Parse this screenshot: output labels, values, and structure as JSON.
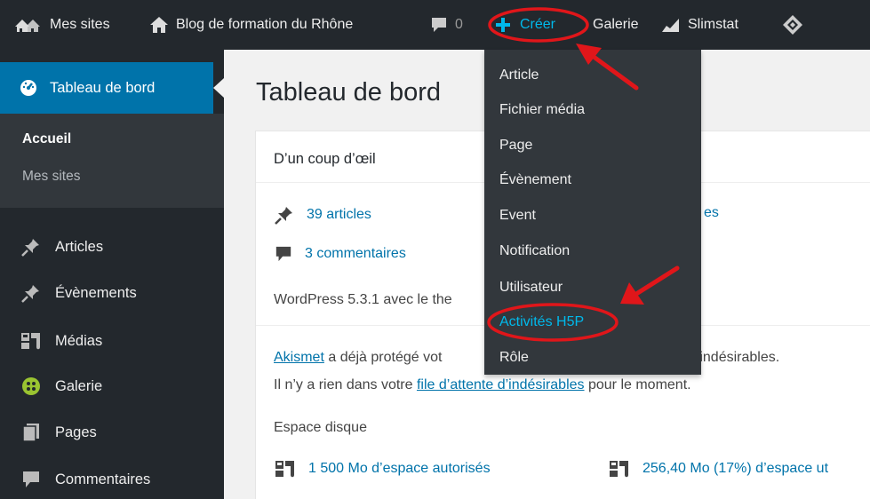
{
  "adminbar": {
    "my_sites": "Mes sites",
    "site_name": "Blog de formation du Rhône",
    "comment_count": "0",
    "create": "Créer",
    "gallery": "Galerie",
    "slimstat": "Slimstat"
  },
  "sidebar": {
    "dashboard": "Tableau de bord",
    "submenu": [
      "Accueil",
      "Mes sites"
    ],
    "items": [
      {
        "label": "Articles",
        "icon": "pin-icon"
      },
      {
        "label": "Évènements",
        "icon": "pin-icon"
      },
      {
        "label": "Médias",
        "icon": "media-icon"
      },
      {
        "label": "Galerie",
        "icon": "gallery-icon"
      },
      {
        "label": "Pages",
        "icon": "pages-icon"
      },
      {
        "label": "Commentaires",
        "icon": "comment-icon"
      }
    ]
  },
  "main": {
    "title": "Tableau de bord",
    "glance": {
      "title": "D’un coup d’œil",
      "articles": "39 articles",
      "comments": "3 commentaires",
      "pages_fragment": "es",
      "wordpress": "WordPress 5.3.1 avec le the",
      "akismet_link": "Akismet",
      "akismet_text": " a déjà protégé vot",
      "akismet_text_end": "es indésirables.",
      "nothing_before": "Il n’y a rien dans votre ",
      "nothing_link": "file d’attente d’indésirables",
      "nothing_after": " pour le moment.",
      "disk_label": "Espace disque",
      "disk_allowed": "1 500 Mo d’espace autorisés",
      "disk_used": "256,40 Mo (17%) d’espace ut"
    }
  },
  "dropdown": {
    "items": [
      "Article",
      "Fichier média",
      "Page",
      "Évènement",
      "Event",
      "Notification",
      "Utilisateur",
      "Activités H5P",
      "Rôle"
    ]
  },
  "colors": {
    "adminbar_bg": "#23282d",
    "submenu_bg": "#32373c",
    "accent_blue": "#0073aa",
    "highlight_blue": "#00b9eb",
    "annotation_red": "#e0161a"
  }
}
